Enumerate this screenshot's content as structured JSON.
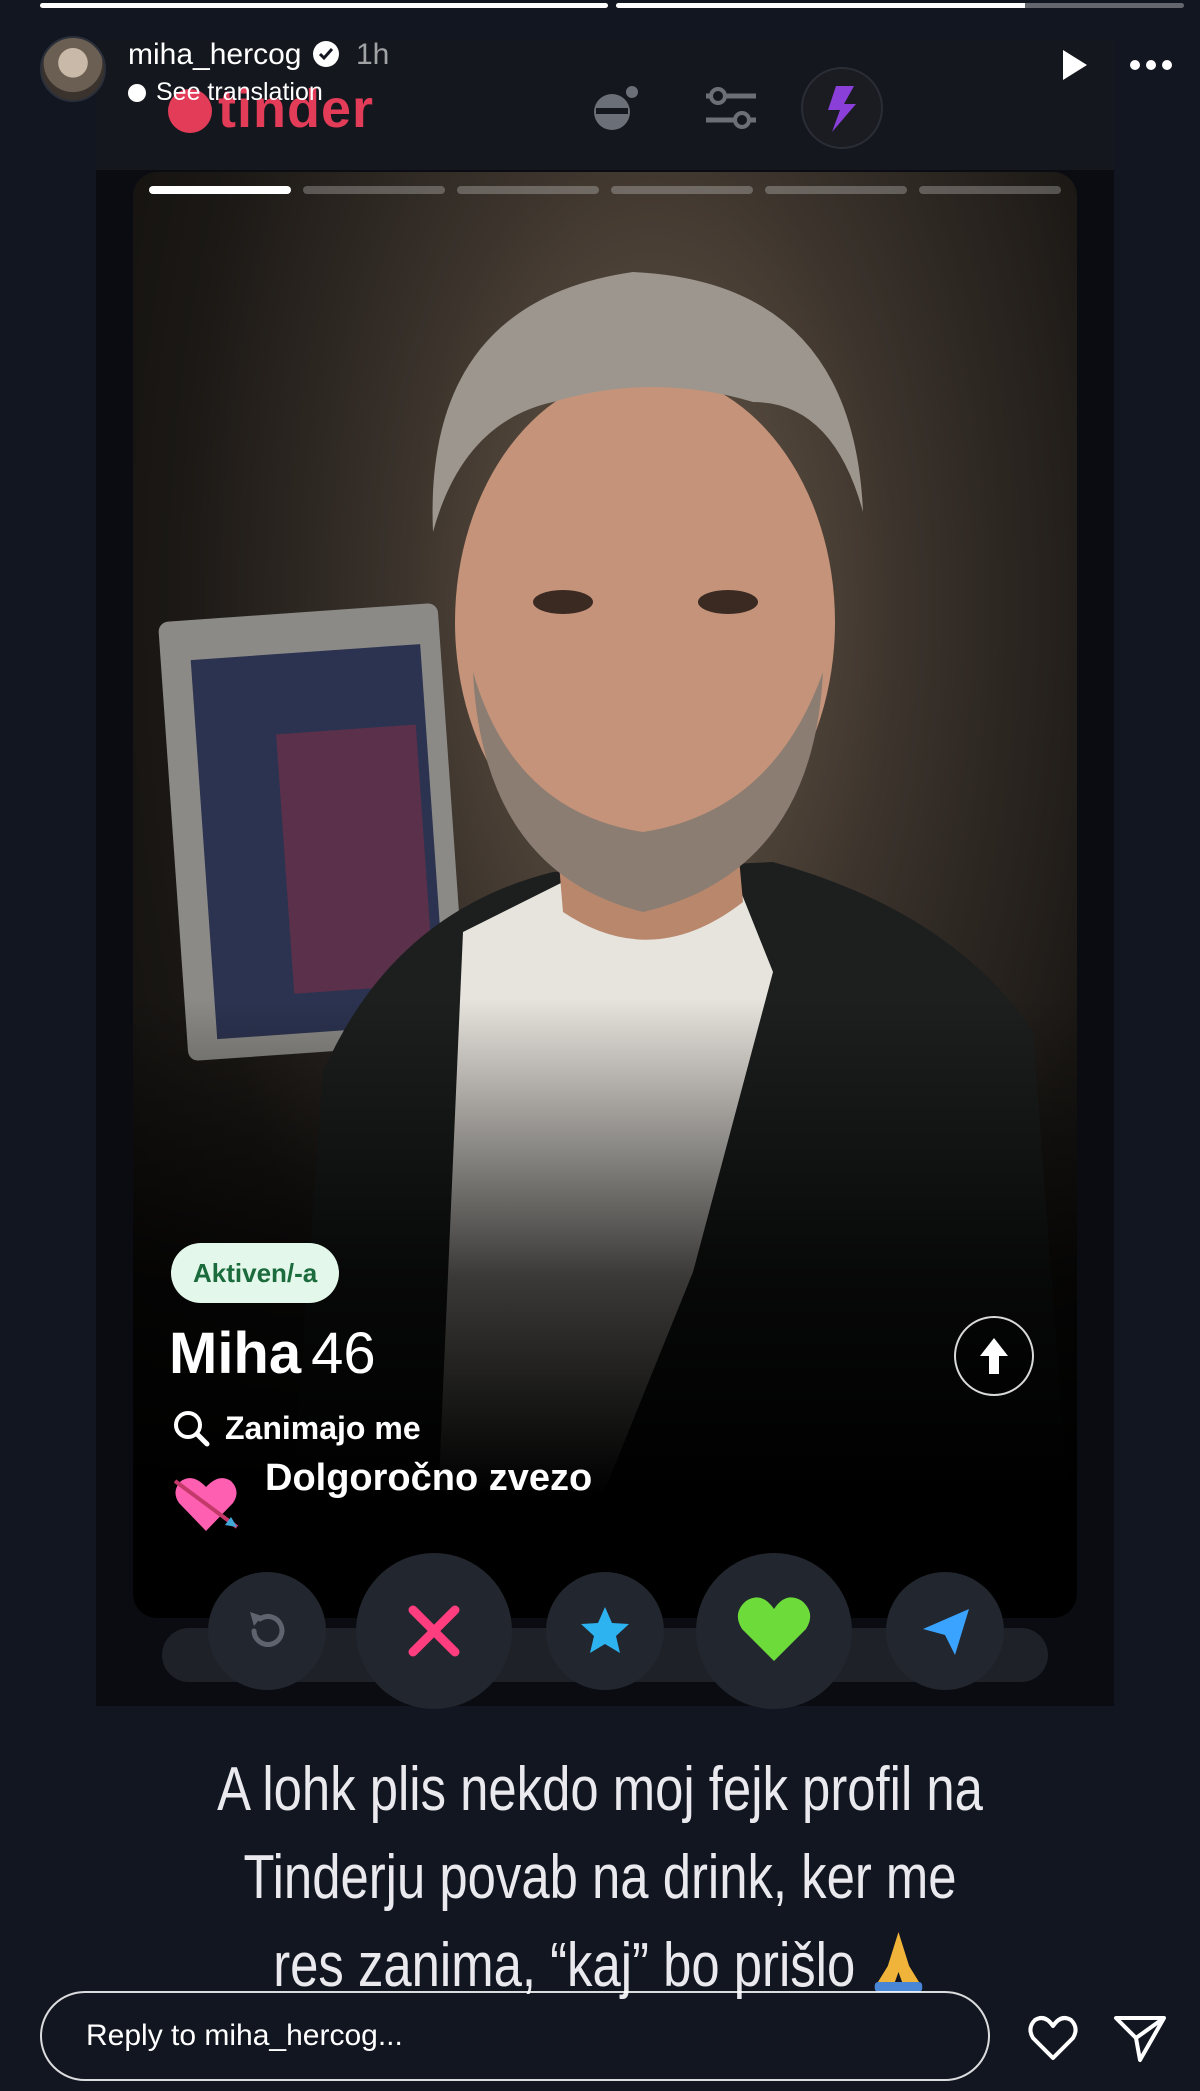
{
  "story": {
    "segments": [
      1,
      0.72
    ],
    "username": "miha_hercog",
    "time": "1h",
    "see_translation": "See translation",
    "icons": {
      "verified": "verified-badge-icon",
      "play": "play-icon",
      "more": "more-icon"
    }
  },
  "tinder": {
    "logo": "tinder",
    "photo_count": 6,
    "active_photo": 1,
    "profile": {
      "status_badge": "Aktiven/-a",
      "name": "Miha",
      "age": "46",
      "looking_for_label": "Zanimajo me",
      "relationship_goal": "Dolgoročno zvezo"
    },
    "actions": [
      "rewind",
      "nope",
      "super-like",
      "like",
      "boost"
    ],
    "colors": {
      "brand": "#e23c58",
      "nope": "#ff3d7f",
      "superlike": "#2db4f0",
      "like": "#6ddc3a",
      "boost": "#3aa2ff"
    }
  },
  "caption": {
    "line1": "A lohk plis nekdo moj fejk profil na",
    "line2": "Tinderju povab na drink, ker me",
    "line3": "res zanima, “kaj” bo prišlo"
  },
  "reply": {
    "placeholder": "Reply to miha_hercog..."
  }
}
